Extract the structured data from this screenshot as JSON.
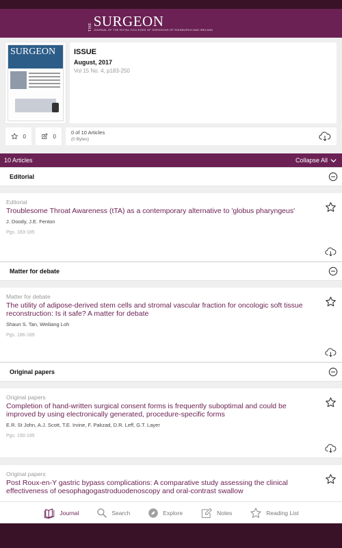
{
  "brand": {
    "the": "THE",
    "name": "SURGEON",
    "subtitle": "JOURNAL OF THE ROYAL COLLEGES OF SURGEONS OF EDINBURGH AND IRELAND"
  },
  "cover": {
    "title": "SURGEON"
  },
  "issue": {
    "label": "ISSUE",
    "date": "August, 2017",
    "volume": "Vol 15 No. 4, p183-250"
  },
  "stats": {
    "favorites": "0",
    "notes": "0",
    "articles": "0 of 10 Articles",
    "size": "(0 Bytes)"
  },
  "list": {
    "count": "10 Articles",
    "collapse_label": "Collapse All"
  },
  "sections": [
    {
      "heading": "Editorial",
      "articles": [
        {
          "section": "Editorial",
          "title": "Troublesome Throat Awareness (tTA) as a contemporary alternative to 'globus pharyngeus'",
          "authors": "J. Doody, J.E. Fenton",
          "pages": "Pgs. 183-185"
        }
      ]
    },
    {
      "heading": "Matter for debate",
      "articles": [
        {
          "section": "Matter for debate",
          "title": "The utility of adipose-derived stem cells and stromal vascular fraction for oncologic soft tissue reconstruction: Is it safe? A matter for debate",
          "authors": "Shaun S. Tan, Weiliang Loh",
          "pages": "Pgs. 186-189"
        }
      ]
    },
    {
      "heading": "Original papers",
      "articles": [
        {
          "section": "Original papers",
          "title": "Completion of hand-written surgical consent forms is frequently suboptimal and could be improved by using electronically generated, procedure-specific forms",
          "authors": "E.R. St John, A.J. Scott, T.E. Irvine, F. Pakzad, D.R. Leff, G.T. Layer",
          "pages": "Pgs. 190-195"
        },
        {
          "section": "Original papers",
          "title": "Post Roux-en-Y gastric bypass complications: A comparative study assessing the clinical effectiveness of oesophagogastroduodenoscopy and oral-contrast swallow",
          "authors": "",
          "pages": ""
        }
      ]
    }
  ],
  "tabs": [
    {
      "label": "Journal",
      "icon": "journal-icon",
      "active": true
    },
    {
      "label": "Search",
      "icon": "search-icon",
      "active": false
    },
    {
      "label": "Explore",
      "icon": "compass-icon",
      "active": false
    },
    {
      "label": "Notes",
      "icon": "notes-icon",
      "active": false
    },
    {
      "label": "Reading List",
      "icon": "star-icon",
      "active": false
    }
  ],
  "colors": {
    "brand": "#6b2154",
    "dark": "#3a1228"
  }
}
